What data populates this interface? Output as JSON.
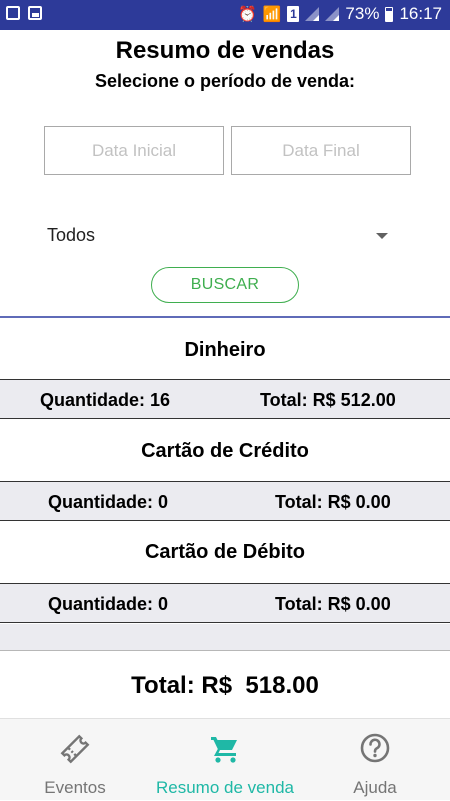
{
  "status_bar": {
    "battery": "73%",
    "time": "16:17",
    "sim": "1"
  },
  "header": {
    "title": "Resumo de vendas",
    "subtitle": "Selecione o período de venda:"
  },
  "filters": {
    "start_date_placeholder": "Data Inicial",
    "end_date_placeholder": "Data Final",
    "select_value": "Todos",
    "search_button": "BUSCAR"
  },
  "payments": [
    {
      "title": "Dinheiro",
      "quantity": "Quantidade: 16",
      "total": "Total: R$ 512.00"
    },
    {
      "title": "Cartão de Crédito",
      "quantity": "Quantidade: 0",
      "total": "Total: R$ 0.00"
    },
    {
      "title": "Cartão de Débito",
      "quantity": "Quantidade: 0",
      "total": "Total: R$ 0.00"
    }
  ],
  "grand_total": "Total: R$  518.00",
  "bottom_nav": {
    "items": [
      {
        "label": "Eventos",
        "icon": "ticket-icon"
      },
      {
        "label": "Resumo de venda",
        "icon": "cart-icon",
        "active": true
      },
      {
        "label": "Ajuda",
        "icon": "help-circle-icon"
      }
    ]
  },
  "colors": {
    "status_bar": "#2d3a99",
    "accent_green": "#3fae4f",
    "active_tab": "#1fb8a6",
    "row_bg": "#ebebf0"
  }
}
